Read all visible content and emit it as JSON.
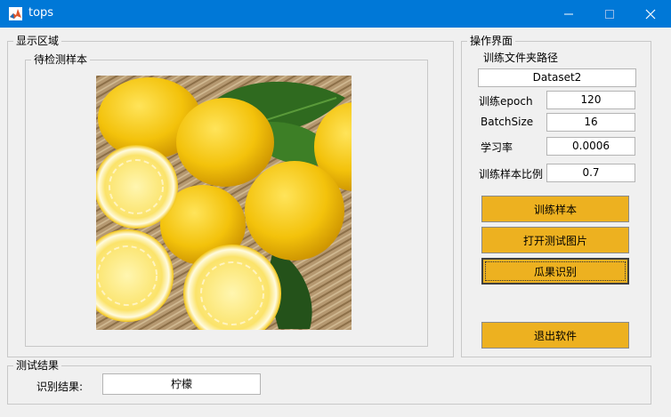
{
  "window": {
    "title": "tops",
    "colors": {
      "titlebar": "#0078d7",
      "button": "#edb120"
    }
  },
  "display": {
    "group_title": "显示区域",
    "sample_group_title": "待检测样本",
    "image_icon": "lemons-photo"
  },
  "controls": {
    "group_title": "操作界面",
    "folder_label": "训练文件夹路径",
    "folder_value": "Dataset2",
    "epoch_label": "训练epoch",
    "epoch_value": "120",
    "batch_label": "BatchSize",
    "batch_value": "16",
    "lr_label": "学习率",
    "lr_value": "0.0006",
    "ratio_label": "训练样本比例",
    "ratio_value": "0.7",
    "train_button": "训练样本",
    "open_button": "打开测试图片",
    "recognize_button": "瓜果识别",
    "exit_button": "退出软件"
  },
  "result": {
    "group_title": "测试结果",
    "label": "识别结果:",
    "value": "柠檬"
  }
}
